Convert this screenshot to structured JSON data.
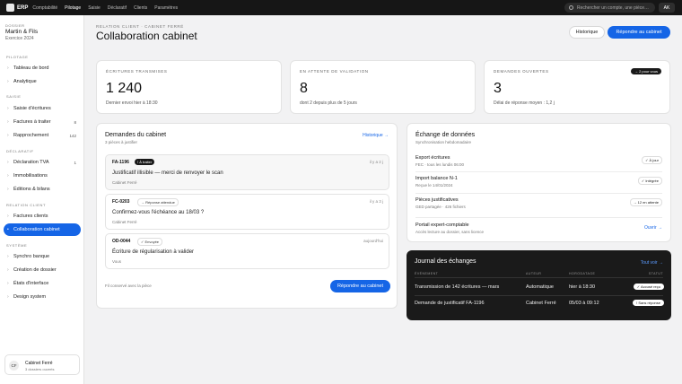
{
  "topbar": {
    "brand": "ERP",
    "nav": [
      "Comptabilité",
      "Pilotage",
      "Saisie",
      "Déclaratif",
      "Clients",
      "Paramètres"
    ],
    "search_placeholder": "Rechercher un compte, une pièce…",
    "user_initials": "AK"
  },
  "sidebar": {
    "dossier_label": "DOSSIER",
    "dossier_name": "Martin & Fils",
    "dossier_year": "Exercice 2024",
    "sections": [
      {
        "label": "PILOTAGE",
        "items": [
          {
            "label": "Tableau de bord",
            "count": ""
          },
          {
            "label": "Analytique",
            "count": ""
          }
        ]
      },
      {
        "label": "SAISIE",
        "items": [
          {
            "label": "Saisie d'écritures",
            "count": ""
          },
          {
            "label": "Factures à traiter",
            "count": "8"
          },
          {
            "label": "Rapprochement",
            "count": "142"
          }
        ]
      },
      {
        "label": "DÉCLARATIF",
        "items": [
          {
            "label": "Déclaration TVA",
            "count": "1"
          },
          {
            "label": "Immobilisations",
            "count": ""
          },
          {
            "label": "Éditions & bilans",
            "count": ""
          }
        ]
      },
      {
        "label": "RELATION CLIENT",
        "items": [
          {
            "label": "Factures clients",
            "count": ""
          },
          {
            "label": "Collaboration cabinet",
            "count": ""
          }
        ]
      },
      {
        "label": "SYSTÈME",
        "items": [
          {
            "label": "Synchro banque",
            "count": ""
          },
          {
            "label": "Création de dossier",
            "count": ""
          },
          {
            "label": "États d'interface",
            "count": ""
          },
          {
            "label": "Design system",
            "count": ""
          }
        ]
      }
    ],
    "user": {
      "initials": "CF",
      "name": "Cabinet Ferré",
      "sub": "3 dossiers ouverts"
    }
  },
  "header": {
    "breadcrumb": "RELATION CLIENT · CABINET FERRÉ",
    "title": "Collaboration cabinet",
    "history_button": "Historique",
    "reply_button": "Répondre au cabinet"
  },
  "stats": [
    {
      "label": "ÉCRITURES TRANSMISES",
      "value": "1 240",
      "sub": "Dernier envoi hier à 18:30",
      "badge": ""
    },
    {
      "label": "EN ATTENTE DE VALIDATION",
      "value": "8",
      "sub": "dont 2 depuis plus de 5 jours",
      "badge": ""
    },
    {
      "label": "DEMANDES OUVERTES",
      "value": "3",
      "sub": "Délai de réponse moyen : 1,2 j",
      "badge": "→ 2 pour vous"
    }
  ],
  "requests": {
    "title": "Demandes du cabinet",
    "sub": "3 pièces à justifier",
    "link": "Historique →",
    "items": [
      {
        "id": "FA-1196",
        "badge": "! À traiter",
        "time": "il y a 2 j",
        "message": "Justificatif illisible — merci de renvoyer le scan",
        "from": "Cabinet Ferré"
      },
      {
        "id": "FC-0203",
        "badge": "→ Réponse attendue",
        "time": "il y a 3 j",
        "message": "Confirmez-vous l'échéance au 18/03 ?",
        "from": "Cabinet Ferré"
      },
      {
        "id": "OD-0044",
        "badge": "✓ Envoyée",
        "time": "aujourd'hui",
        "message": "Écriture de régularisation à valider",
        "from": "Vous"
      }
    ],
    "footer_note": "Fil conservé avec la pièce",
    "reply_button": "Répondre au cabinet"
  },
  "exchange": {
    "title": "Échange de données",
    "sub": "Synchronisation hebdomadaire",
    "rows": [
      {
        "name": "Export écritures",
        "sub": "FEC · tous les lundis 06:00",
        "badge": "✓ À jour"
      },
      {
        "name": "Import balance N-1",
        "sub": "Reçue le 14/01/2024",
        "badge": "✓ Intégrée"
      },
      {
        "name": "Pièces justificatives",
        "sub": "GED partagée · 426 fichiers",
        "badge": "→ 12 en attente"
      },
      {
        "name": "Portail expert-comptable",
        "sub": "Accès lecture au dossier, sans licence",
        "badge": ""
      }
    ],
    "open_link": "Ouvrir →"
  },
  "journal": {
    "title": "Journal des échanges",
    "link": "Tout voir →",
    "headers": [
      "ÉVÉNEMENT",
      "AUTEUR",
      "HORODATAGE",
      "STATUT"
    ],
    "rows": [
      {
        "event": "Transmission de 142 écritures — mars",
        "author": "Automatique",
        "time": "hier à 18:30",
        "status": "✓ Accusé reçu"
      },
      {
        "event": "Demande de justificatif FA-1196",
        "author": "Cabinet Ferré",
        "time": "05/03 à 09:12",
        "status": "! Sans réponse"
      }
    ]
  }
}
